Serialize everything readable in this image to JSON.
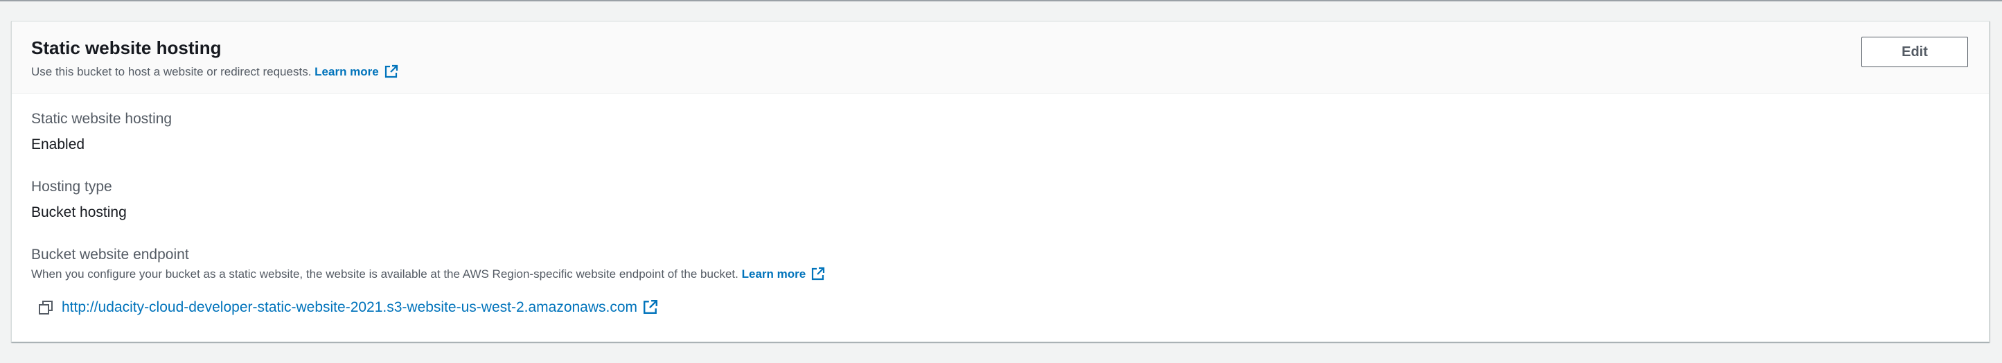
{
  "section": {
    "title": "Static website hosting",
    "description": "Use this bucket to host a website or redirect requests.",
    "learn_more": "Learn more",
    "edit_label": "Edit"
  },
  "fields": {
    "hosting_label": "Static website hosting",
    "hosting_value": "Enabled",
    "type_label": "Hosting type",
    "type_value": "Bucket hosting",
    "endpoint_label": "Bucket website endpoint",
    "endpoint_description": "When you configure your bucket as a static website, the website is available at the AWS Region-specific website endpoint of the bucket.",
    "endpoint_learn_more": "Learn more",
    "endpoint_url": "http://udacity-cloud-developer-static-website-2021.s3-website-us-west-2.amazonaws.com"
  },
  "icons": {
    "external": "external-link-icon",
    "copy": "copy-icon"
  },
  "colors": {
    "link": "#0073bb",
    "page_bg": "#f2f3f3",
    "header_bg": "#fafafa",
    "text": "#16191f",
    "muted": "#545b64"
  }
}
